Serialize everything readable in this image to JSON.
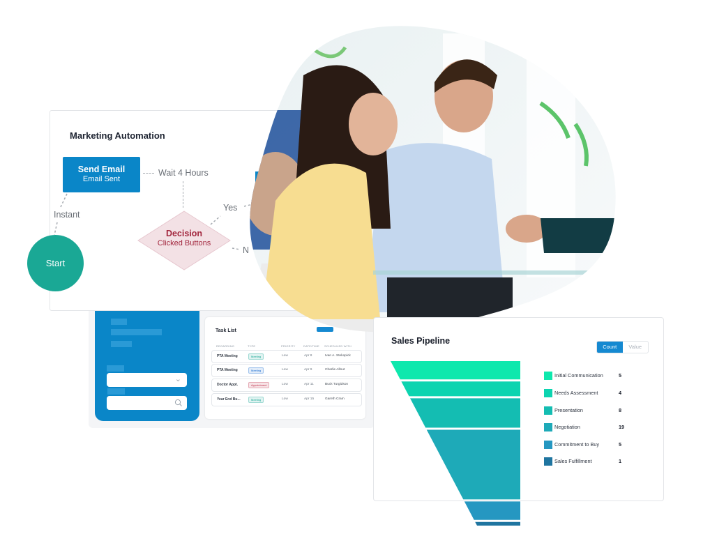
{
  "task_panel": {
    "search_dropdown_icon": "chevron-down-icon",
    "search_icon": "search-icon",
    "task_list": {
      "title": "Task List",
      "columns": [
        "REGARDING",
        "TYPE",
        "PRIORITY",
        "DATE/TIME",
        "SCHEDULED WITH"
      ],
      "rows": [
        {
          "regarding": "PTA Meeting",
          "type": "Meeting",
          "type_color": "#1aa895",
          "priority": "Low",
          "date": "Apr 8",
          "with": "Ivan A. Stekopick"
        },
        {
          "regarding": "PTA Meeting",
          "type": "Meeting",
          "type_color": "#1f6fd1",
          "priority": "Low",
          "date": "Apr 9",
          "with": "Charlie Allnut"
        },
        {
          "regarding": "Doctor Appt.",
          "type": "Appointment",
          "type_color": "#c0344e",
          "priority": "Low",
          "date": "Apr 11",
          "with": "Buck Turgidson"
        },
        {
          "regarding": "Year End Bu...",
          "type": "Meeting",
          "type_color": "#1aa895",
          "priority": "Low",
          "date": "Apr 15",
          "with": "Gareth Cram"
        }
      ]
    }
  },
  "marketing_automation": {
    "title": "Marketing Automation",
    "send_email": {
      "title": "Send Email",
      "subtitle": "Email Sent"
    },
    "wait_label": "Wait 4 Hours",
    "instant_label": "Instant",
    "decision": {
      "title": "Decision",
      "subtitle": "Clicked Buttons"
    },
    "yes_label": "Yes",
    "no_label": "N",
    "start_label": "Start",
    "colors": {
      "primary": "#0a86c8",
      "start": "#1aa895",
      "decision_fill": "#f3e1e5",
      "decision_text": "#a3283f"
    }
  },
  "photo": {
    "description": "business people shaking hands in office"
  },
  "sales_pipeline": {
    "title": "Sales Pipeline",
    "toggle": {
      "count_label": "Count",
      "value_label": "Value",
      "selected": "Count"
    }
  },
  "chart_data": {
    "type": "funnel",
    "title": "Sales Pipeline",
    "categories": [
      "Initial Communication",
      "Needs Assessment",
      "Presentation",
      "Negotiation",
      "Commitment to Buy",
      "Sales Fulfillment"
    ],
    "values": [
      5,
      4,
      8,
      19,
      5,
      1
    ],
    "colors": [
      "#0ee8ad",
      "#0cd4b0",
      "#14bdb2",
      "#1eaab8",
      "#2597c1",
      "#1f75a0"
    ],
    "legend": "right"
  }
}
